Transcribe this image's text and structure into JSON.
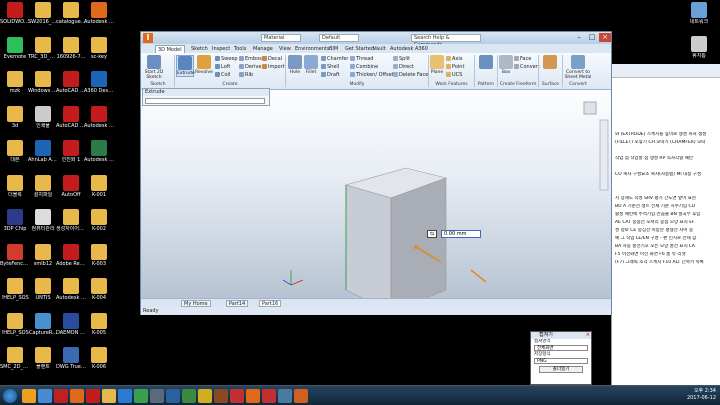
{
  "desktop": {
    "icons_col1": [
      {
        "label": "SOLIDWO... 2016 x64 ...",
        "color": "#c41c1c"
      },
      {
        "label": "Evernote",
        "color": "#2dbe60"
      },
      {
        "label": "mzk",
        "color": "#e8b84a"
      },
      {
        "label": "3d",
        "color": "#e8b84a"
      },
      {
        "label": "대본",
        "color": "#e8b84a"
      },
      {
        "label": "더블록",
        "color": "#e8b84a"
      },
      {
        "label": "3DP Chip",
        "color": "#2a3c8c"
      },
      {
        "label": "ByteFence Anti-Malware",
        "color": "#d23c2c"
      },
      {
        "label": "!HELP_SOS",
        "color": "#e8b84a"
      },
      {
        "label": "!HELP_SOS",
        "color": "#e8b84a"
      },
      {
        "label": "SMC_2D_3...",
        "color": "#e8b84a"
      }
    ],
    "icons_col2": [
      {
        "label": "SW2016_S...",
        "color": "#e8b84a"
      },
      {
        "label": "TRC_3D_m...",
        "color": "#e8b84a"
      },
      {
        "label": "Windows 7 160712 활성",
        "color": "#e8b84a"
      },
      {
        "label": "인쇄물",
        "color": "#cccccc"
      },
      {
        "label": "AhnLab Anti-Ranso...",
        "color": "#1e64b4"
      },
      {
        "label": "설치파일",
        "color": "#e8b84a"
      },
      {
        "label": "컴퓨터관리",
        "color": "#dddddd"
      },
      {
        "label": "smlb12",
        "color": "#e8b84a"
      },
      {
        "label": "UNTIS",
        "color": "#e8b84a"
      },
      {
        "label": "CaptureR...",
        "color": "#4a90d0"
      },
      {
        "label": "플랜트",
        "color": "#e8b84a"
      }
    ],
    "icons_col3": [
      {
        "label": "catalogue_...",
        "color": "#e8b84a"
      },
      {
        "label": "160926-7...",
        "color": "#e8b84a"
      },
      {
        "label": "AutoCAD 2011",
        "color": "#c41c1c"
      },
      {
        "label": "AutoCAD 2017 - 한...",
        "color": "#c41c1c"
      },
      {
        "label": "인진화 1",
        "color": "#c41c1c"
      },
      {
        "label": "AutoOff",
        "color": "#c41c1c"
      },
      {
        "label": "생성자이어트 품목리...",
        "color": "#e8b84a"
      },
      {
        "label": "Adobe Reader XI",
        "color": "#c41c1c"
      },
      {
        "label": "Autodesk I...",
        "color": "#e8b84a"
      },
      {
        "label": "DAEMON Tools Lite",
        "color": "#2a4c9c"
      },
      {
        "label": "DWG TrueVie...",
        "color": "#3a6ab0"
      }
    ],
    "icons_col4": [
      {
        "label": "Autodesk Invento...",
        "color": "#e06a1a"
      },
      {
        "label": "sc-key",
        "color": "#e8b84a"
      },
      {
        "label": "A360 Desktop",
        "color": "#1e64b4"
      },
      {
        "label": "Autodesk ReCap 2016",
        "color": "#c41c1c"
      },
      {
        "label": "Autodesk Vault Bas...",
        "color": "#2a7a4a"
      },
      {
        "label": "K-001",
        "color": "#e8b84a"
      },
      {
        "label": "K-002",
        "color": "#e8b84a"
      },
      {
        "label": "K-003",
        "color": "#e8b84a"
      },
      {
        "label": "K-004",
        "color": "#e8b84a"
      },
      {
        "label": "K-005",
        "color": "#e8b84a"
      },
      {
        "label": "K-006",
        "color": "#e8b84a"
      }
    ],
    "right_icons": [
      {
        "label": "네트워크",
        "color": "#6aa0d8"
      },
      {
        "label": "휴지통",
        "color": "#cccccc"
      }
    ]
  },
  "inventor": {
    "logo": "I",
    "title_material": "Material",
    "title_appearance": "Default",
    "search_placeholder": "Search Help & Commands...",
    "tabs": [
      "3D Model",
      "Sketch",
      "Inspect",
      "Tools",
      "Manage",
      "View",
      "Environments",
      "BIM",
      "Get Started",
      "Vault",
      "Autodesk A360"
    ],
    "ribbon": {
      "start_sketch": "Start 2D Sketch",
      "extrude": "Extrude",
      "revolve": "Revolve",
      "create_col1": [
        "Sweep",
        "Loft",
        "Coil"
      ],
      "create_col2": [
        "Emboss",
        "Derive",
        "Rib"
      ],
      "create_col3": [
        "Decal",
        "Import"
      ],
      "hole": "Hole",
      "fillet": "Fillet",
      "modify_col1": [
        "Chamfer",
        "Shell",
        "Draft"
      ],
      "modify_col2": [
        "Thread",
        "Combine",
        "Thicken/ Offset"
      ],
      "modify_col3": [
        "Split",
        "Direct",
        "Delete Face"
      ],
      "plane": "Plane",
      "work_col": [
        "Axis",
        "Point",
        "UCS"
      ],
      "pattern_label": "Pattern",
      "box": "Box",
      "freeform_col": [
        "Face",
        "Convert"
      ],
      "surface_label": "Surface",
      "convert_sheet": "Convert to Sheet Metal",
      "groups": [
        "Sketch",
        "Create",
        "Modify",
        "Work Features",
        "Pattern",
        "Create Freeform",
        "Surface",
        "Convert"
      ]
    },
    "browser_title": "Extrude",
    "doc_tabs": [
      "My Home",
      "Part14",
      "Part16"
    ],
    "status": "Ready",
    "dim_value": "0.00 mm"
  },
  "background_doc": {
    "lines": [
      "와 (EXTRUDE) 스케치를 높이로 생성 피처 생성",
      "(FILLET) 모깎기  CH 모따기 (CHAMFER) 모따",
      "작업 점 작업할 점 생성  RP 직사각형 패턴",
      "CO 복사 구성요소 복사(사용법)  MI 대칭 구성",
      "치 상세도 작성  SRV 평기 간도면 옆어 표현",
      "BO A 기준선 생트 전제 기준 치수기입  CO",
      "활성 패턴에 주석기입 만끔풀 BN 절곡부 후입",
      "AE  CAT 중점선 모서리 중점 모양 표시  EF",
      "성 정보  CE 중심선 이등분 평형선 사이 중",
      "예 그 작업  LE/EN 구성 - 편 인치로 전제 값",
      "BA 자동 풍선기호 모든 모양 풍선 표시  LA",
      "F5 이전화면 이전 화면  F6 홈 뷰 리셋",
      "(F7) 그래픽 조각 스케치 F10 ALT 단축키 목록"
    ]
  },
  "capture_dialog": {
    "title": "캡쳐기",
    "close": "×",
    "area_label": "캡쳐영역",
    "area_value": "전체화면",
    "format_label": "저장형식",
    "format_value": "PNG",
    "open_button": "폴더열기"
  },
  "tray": {
    "time": "오후 2:34",
    "date": "2017-06-12"
  }
}
